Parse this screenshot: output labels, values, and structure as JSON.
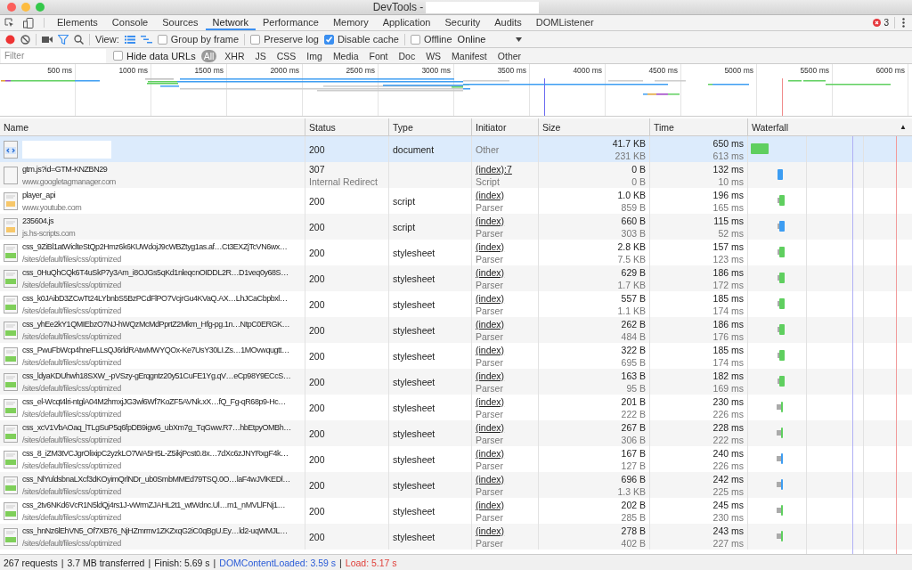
{
  "window": {
    "title": "DevTools -"
  },
  "tabs": [
    {
      "label": "Elements",
      "selected": false
    },
    {
      "label": "Console",
      "selected": false
    },
    {
      "label": "Sources",
      "selected": false
    },
    {
      "label": "Network",
      "selected": true
    },
    {
      "label": "Performance",
      "selected": false
    },
    {
      "label": "Memory",
      "selected": false
    },
    {
      "label": "Application",
      "selected": false
    },
    {
      "label": "Security",
      "selected": false
    },
    {
      "label": "Audits",
      "selected": false
    },
    {
      "label": "DOMListener",
      "selected": false
    }
  ],
  "errors": {
    "count": "3"
  },
  "toolbar": {
    "recording": true,
    "filter_active": true,
    "view_label": "View:",
    "checkboxes": [
      {
        "label": "Group by frame",
        "checked": false
      },
      {
        "label": "Preserve log",
        "checked": false
      },
      {
        "label": "Disable cache",
        "checked": true
      },
      {
        "label": "Offline",
        "checked": false
      }
    ],
    "throttle": "Online"
  },
  "filter_bar": {
    "placeholder": "Filter",
    "hide_data_urls": {
      "label": "Hide data URLs",
      "checked": false
    },
    "types": [
      {
        "label": "All",
        "selected": true
      },
      {
        "label": "XHR",
        "selected": false
      },
      {
        "label": "JS",
        "selected": false
      },
      {
        "label": "CSS",
        "selected": false
      },
      {
        "label": "Img",
        "selected": false
      },
      {
        "label": "Media",
        "selected": false
      },
      {
        "label": "Font",
        "selected": false
      },
      {
        "label": "Doc",
        "selected": false
      },
      {
        "label": "WS",
        "selected": false
      },
      {
        "label": "Manifest",
        "selected": false
      },
      {
        "label": "Other",
        "selected": false
      }
    ]
  },
  "overview": {
    "ticks": [
      "500 ms",
      "1000 ms",
      "1500 ms",
      "2000 ms",
      "2500 ms",
      "3000 ms",
      "3500 ms",
      "4000 ms",
      "4500 ms",
      "5000 ms",
      "5500 ms",
      "6000 ms"
    ]
  },
  "table": {
    "columns": [
      "Name",
      "Status",
      "Type",
      "Initiator",
      "Size",
      "Time",
      "Waterfall"
    ],
    "sort_indicator": "▲",
    "rows": [
      {
        "selected": true,
        "status": "200",
        "type": "document",
        "initiator": "Other",
        "size": "41.7 KB",
        "size_sub": "231 KB",
        "time": "650 ms",
        "time_sub": "613 ms",
        "color": "#5fcf5f"
      },
      {
        "selected": false,
        "name": "gtm.js?id=GTM-KNZBN29",
        "domain": "www.googletagmanager.com",
        "status": "307",
        "status_sub": "Internal Redirect",
        "initiator": "(index):7",
        "initiator_sub": "Script",
        "size": "0 B",
        "size_sub": "0 B",
        "time": "132 ms",
        "time_sub": "10 ms",
        "color": "#3d9df2"
      },
      {
        "selected": false,
        "name": "player_api",
        "domain": "www.youtube.com",
        "status": "200",
        "type": "script",
        "initiator": "(index)",
        "initiator_sub": "Parser",
        "size": "1.0 KB",
        "size_sub": "859 B",
        "time": "196 ms",
        "time_sub": "165 ms",
        "color": "#5fcf5f"
      },
      {
        "selected": false,
        "name": "235604.js",
        "domain": "js.hs-scripts.com",
        "status": "200",
        "type": "script",
        "initiator": "(index)",
        "initiator_sub": "Parser",
        "size": "660 B",
        "size_sub": "303 B",
        "time": "115 ms",
        "time_sub": "52 ms",
        "color": "#3d9df2"
      },
      {
        "selected": false,
        "name": "css_9ZiBl1atWiclteStQp2Hmz6k6KUWdojJ9cWBZtyg1as.af…Ct3EXZjTcVN6wx…",
        "domain": "/sites/default/files/css/optimized",
        "status": "200",
        "type": "stylesheet",
        "initiator": "(index)",
        "initiator_sub": "Parser",
        "size": "2.8 KB",
        "size_sub": "7.5 KB",
        "time": "157 ms",
        "time_sub": "123 ms",
        "color": "#5fcf5f"
      },
      {
        "selected": false,
        "name": "css_0HuQhCQk6T4uSkP7y3Am_i8OJGs5qKd1nleqcnOIDDL2R…D1veq0y68S…",
        "domain": "/sites/default/files/css/optimized",
        "status": "200",
        "type": "stylesheet",
        "initiator": "(index)",
        "initiator_sub": "Parser",
        "size": "629 B",
        "size_sub": "1.7 KB",
        "time": "186 ms",
        "time_sub": "172 ms",
        "color": "#5fcf5f"
      },
      {
        "selected": false,
        "name": "css_k0JAibD3ZCwTt24LYbnbS5BzPCdFlPO7VcjrGu4KVaQ.AX…LhJCaCbpbxl…",
        "domain": "/sites/default/files/css/optimized",
        "status": "200",
        "type": "stylesheet",
        "initiator": "(index)",
        "initiator_sub": "Parser",
        "size": "557 B",
        "size_sub": "1.1 KB",
        "time": "185 ms",
        "time_sub": "174 ms",
        "color": "#5fcf5f"
      },
      {
        "selected": false,
        "name": "css_yhEe2kY1QMIEbzO7NJ-hWQzMcMdPprtZ2Mkm_Hfg-pg.1n…NtpC0ERGK…",
        "domain": "/sites/default/files/css/optimized",
        "status": "200",
        "type": "stylesheet",
        "initiator": "(index)",
        "initiator_sub": "Parser",
        "size": "262 B",
        "size_sub": "484 B",
        "time": "186 ms",
        "time_sub": "176 ms",
        "color": "#5fcf5f"
      },
      {
        "selected": false,
        "name": "css_PwuFbWcp4hneFLLsQJ6rldRAtwMWYQOx-Ke7UsY30LI.Zs…1MOvwqugtt…",
        "domain": "/sites/default/files/css/optimized",
        "status": "200",
        "type": "stylesheet",
        "initiator": "(index)",
        "initiator_sub": "Parser",
        "size": "322 B",
        "size_sub": "695 B",
        "time": "185 ms",
        "time_sub": "174 ms",
        "color": "#5fcf5f"
      },
      {
        "selected": false,
        "name": "css_ldyaKDUhwh18SXW_-pVSzy-gErqgntz20y51CuFE1Yg.qV…eCp98Y9ECcS…",
        "domain": "/sites/default/files/css/optimized",
        "status": "200",
        "type": "stylesheet",
        "initiator": "(index)",
        "initiator_sub": "Parser",
        "size": "163 B",
        "size_sub": "95 B",
        "time": "182 ms",
        "time_sub": "169 ms",
        "color": "#5fcf5f"
      },
      {
        "selected": false,
        "name": "css_el-Wcqt4lri-ntglA04M2hmxjJG3wl6Wf7KoZF5AVNk.xX…fQ_Fg-qR68p9-Hc…",
        "domain": "/sites/default/files/css/optimized",
        "status": "200",
        "type": "stylesheet",
        "initiator": "(index)",
        "initiator_sub": "Parser",
        "size": "201 B",
        "size_sub": "222 B",
        "time": "230 ms",
        "time_sub": "226 ms",
        "color": "#5fcf5f"
      },
      {
        "selected": false,
        "name": "css_xcV1VbAOaq_lTLgSuP5q6fpDB9igw6_ubXm7g_TqGww.R7…hbEtpyOMBh…",
        "domain": "/sites/default/files/css/optimized",
        "status": "200",
        "type": "stylesheet",
        "initiator": "(index)",
        "initiator_sub": "Parser",
        "size": "267 B",
        "size_sub": "306 B",
        "time": "228 ms",
        "time_sub": "222 ms",
        "color": "#5fcf5f"
      },
      {
        "selected": false,
        "name": "css_8_iZM3tVCJgrOlixipC2yzkLO7WA5H5L-Z5ikjPcst0.8x…7dXc6zJNYRxgF4k…",
        "domain": "/sites/default/files/css/optimized",
        "status": "200",
        "type": "stylesheet",
        "initiator": "(index)",
        "initiator_sub": "Parser",
        "size": "167 B",
        "size_sub": "127 B",
        "time": "240 ms",
        "time_sub": "226 ms",
        "color": "#3d9df2"
      },
      {
        "selected": false,
        "name": "css_NlYuldsbnaLXcf3dKOyimQrlNDr_ub0SmbMMEd79TSQ.0O…laF4wJVlKEDl…",
        "domain": "/sites/default/files/css/optimized",
        "status": "200",
        "type": "stylesheet",
        "initiator": "(index)",
        "initiator_sub": "Parser",
        "size": "696 B",
        "size_sub": "1.3 KB",
        "time": "242 ms",
        "time_sub": "225 ms",
        "color": "#3d9df2"
      },
      {
        "selected": false,
        "name": "css_2tv6NKd6VcR1N5ldQj4rs1J-vWrmZJAHL2t1_wtWdnc.Ul…m1_nMVLlFNj1…",
        "domain": "/sites/default/files/css/optimized",
        "status": "200",
        "type": "stylesheet",
        "initiator": "(index)",
        "initiator_sub": "Parser",
        "size": "202 B",
        "size_sub": "285 B",
        "time": "245 ms",
        "time_sub": "230 ms",
        "color": "#5fcf5f"
      },
      {
        "selected": false,
        "name": "css_hnNz6lEhVN5_Of7XB76_NjHZmrmv1ZKZxqG2iC0qBgU.Ey…ld2-uqWMJL…",
        "domain": "/sites/default/files/css/optimized",
        "status": "200",
        "type": "stylesheet",
        "initiator": "(index)",
        "initiator_sub": "Parser",
        "size": "278 B",
        "size_sub": "402 B",
        "time": "243 ms",
        "time_sub": "227 ms",
        "color": "#5fcf5f"
      }
    ]
  },
  "status_bar": [
    {
      "text": "267 requests",
      "kind": "plain"
    },
    {
      "text": "|",
      "kind": "separator"
    },
    {
      "text": "3.7 MB transferred",
      "kind": "plain"
    },
    {
      "text": "|",
      "kind": "separator"
    },
    {
      "text": "Finish: 5.69 s",
      "kind": "plain"
    },
    {
      "text": "|",
      "kind": "separator"
    },
    {
      "text": "DOMContentLoaded: 3.59 s",
      "kind": "dom"
    },
    {
      "text": "|",
      "kind": "separator"
    },
    {
      "text": "Load: 5.17 s",
      "kind": "load"
    }
  ]
}
